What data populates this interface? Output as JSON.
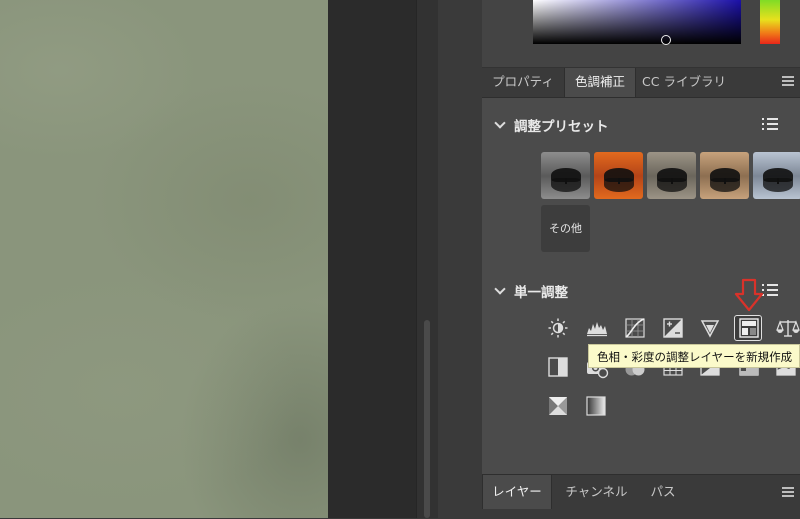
{
  "tabs": [
    {
      "label": "プロパティ",
      "active": false
    },
    {
      "label": "色調補正",
      "active": true
    },
    {
      "label": "CC ライブラリ",
      "active": false
    }
  ],
  "presets_section": {
    "title": "調整プリセット"
  },
  "presets": [
    {
      "name": "black-white-preset",
      "sky": "#8d8d8d",
      "water": "#5a5a5a"
    },
    {
      "name": "orange-sunset-preset",
      "sky": "#e26a1e",
      "water": "#b44418"
    },
    {
      "name": "muted-color-preset",
      "sky": "#9c9486",
      "water": "#6b665c"
    },
    {
      "name": "warm-sepia-preset",
      "sky": "#c7a27c",
      "water": "#8d6f51"
    },
    {
      "name": "cool-blue-preset",
      "sky": "#b9c4d2",
      "water": "#7d8796"
    }
  ],
  "other_label": "その他",
  "single_section": {
    "title": "単一調整"
  },
  "adjustment_icons": [
    "brightness-contrast-icon",
    "levels-icon",
    "curves-icon",
    "exposure-icon",
    "vibrance-icon",
    "hue-saturation-icon",
    "color-balance-icon",
    "black-white-icon",
    "photo-filter-icon",
    "channel-mixer-icon",
    "color-lookup-icon",
    "invert-icon",
    "posterize-icon",
    "threshold-icon",
    "selective-color-icon",
    "gradient-map-icon"
  ],
  "tooltip": "色相・彩度の調整レイヤーを新規作成",
  "bottom_tabs": [
    {
      "label": "レイヤー",
      "active": true
    },
    {
      "label": "チャンネル",
      "active": false
    },
    {
      "label": "パス",
      "active": false
    }
  ],
  "colors": {
    "annotation_arrow": "#d9322a",
    "tooltip_bg": "#fbfaca"
  }
}
